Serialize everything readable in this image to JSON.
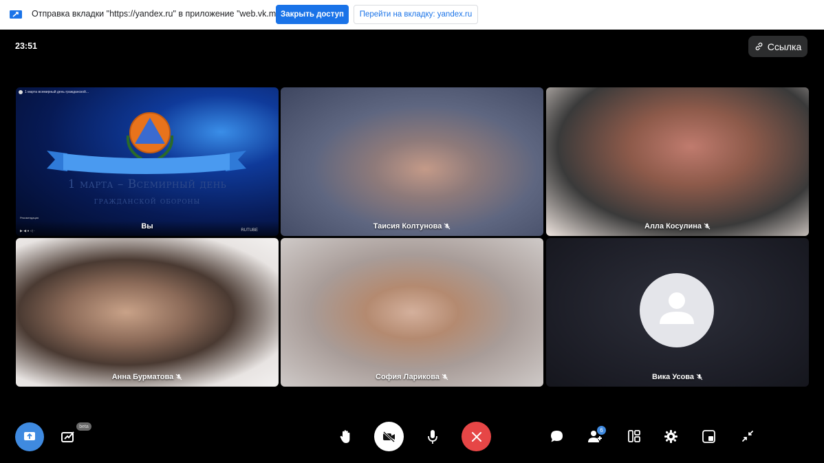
{
  "share_bar": {
    "message": "Отправка вкладки \"https://yandex.ru\" в приложение \"web.vk.me\"...",
    "stop_button": "Закрыть доступ",
    "goto_button": "Перейти на вкладку: yandex.ru",
    "accent_color": "#1a73e8"
  },
  "header": {
    "time": "23:51",
    "link_button": "Ссылка"
  },
  "tiles": [
    {
      "name": "Вы",
      "type": "presentation",
      "slide": {
        "video_title": "1 марта всемирный день гражданской...",
        "line1": "1 марта – Всемирный день",
        "line2": "гражданской обороны",
        "player_brand": "RUTUBE",
        "channel_label": "Рекомендация"
      }
    },
    {
      "name": "Таисия Колтунова",
      "muted": true
    },
    {
      "name": "Алла Косулина",
      "muted": true
    },
    {
      "name": "Анна Бурматова",
      "muted": true
    },
    {
      "name": "София Ларикова",
      "muted": true
    },
    {
      "name": "Вика Усова",
      "muted": true,
      "avatar_placeholder": "user-icon"
    }
  ],
  "controls": {
    "beta_label": "beta",
    "participants_count": "6",
    "end_color": "#e64646",
    "accent_color": "#3f8ae0"
  }
}
